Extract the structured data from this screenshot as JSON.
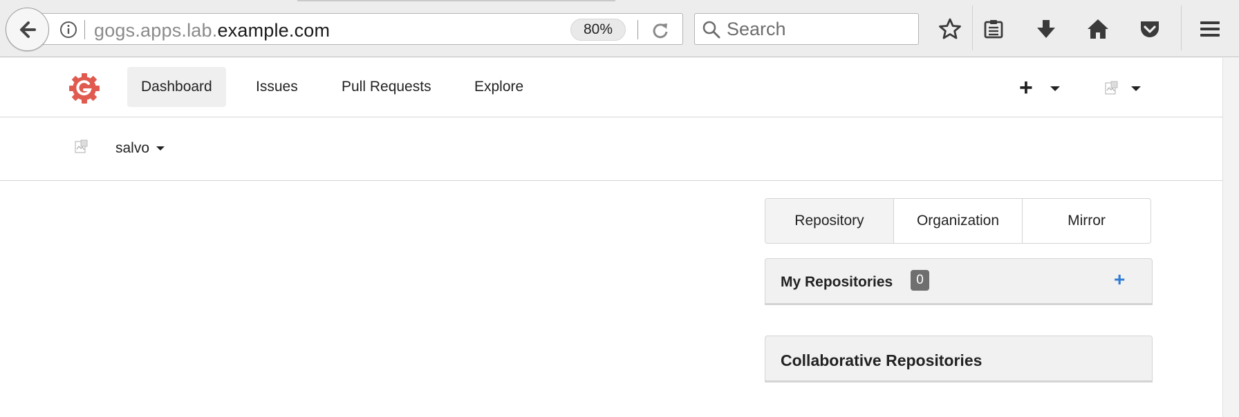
{
  "browser": {
    "url_prefix": "gogs.apps.lab.",
    "url_domain": "example.com",
    "zoom": "80%",
    "search_placeholder": "Search",
    "icons": [
      "back-icon",
      "info-icon",
      "reload-icon",
      "search-icon",
      "bookmark-star-icon",
      "reading-list-icon",
      "download-icon",
      "home-icon",
      "pocket-icon",
      "hamburger-menu-icon"
    ]
  },
  "header": {
    "nav": [
      "Dashboard",
      "Issues",
      "Pull Requests",
      "Explore"
    ],
    "active_nav": "Dashboard",
    "create_label": "+"
  },
  "context": {
    "username": "salvo"
  },
  "main": {
    "tabs": [
      "Repository",
      "Organization",
      "Mirror"
    ],
    "active_tab": "Repository",
    "my_repos": {
      "title": "My Repositories",
      "count": "0",
      "add_label": "+"
    },
    "collab_repos": {
      "title": "Collaborative Repositories"
    }
  },
  "colors": {
    "brand": "#e05a4f",
    "accent": "#2f7bd4",
    "badge": "#6f6f6f"
  }
}
